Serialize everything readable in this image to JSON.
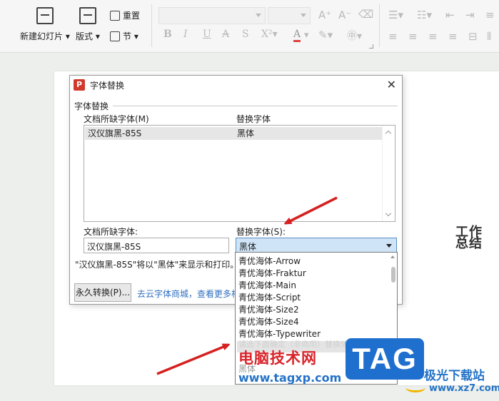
{
  "ribbon": {
    "new_slide": "新建幻灯片",
    "layout": "版式",
    "reset": "重置",
    "section": "节",
    "font_color_letter": "A"
  },
  "dialog": {
    "title": "字体替换",
    "logo_letter": "P",
    "group_label": "字体替换",
    "col_missing": "文档所缺字体(M)",
    "col_replace": "替换字体",
    "list_rows": [
      {
        "missing": "汉仪旗黑-85S",
        "replace": "黑体"
      }
    ],
    "missing_label": "文档所缺字体:",
    "replace_label": "替换字体(S):",
    "missing_value": "汉仪旗黑-85S",
    "replace_value": "黑体",
    "info_text": "\"汉仪旗黑-85S\"将以\"黑体\"来显示和打印。",
    "permanent_button": "永久转换(P)...",
    "link_text": "去云字体商城，查看更多相"
  },
  "dropdown": {
    "options": [
      "青优海体-Arrow",
      "青优海体-Fraktur",
      "青优海体-Main",
      "青优海体-Script",
      "青优海体-Size2",
      "青优海体-Size4",
      "青优海体-Typewriter"
    ],
    "faint_item": "请选下面确定（非商用）替换体",
    "last_item": "黑体"
  },
  "slide": {
    "text": "工作总结"
  },
  "watermark": {
    "site_name": "电脑技术网",
    "site_url": "www.tagxp.com",
    "tag": "TAG",
    "jiguang": "极光下载站",
    "xz_url": "www.xz7.com"
  },
  "colors": {
    "accent_red": "#d9232a",
    "arrow_red": "#d62020",
    "link_blue": "#2f6fc0",
    "tag_blue": "#1f6fcf"
  }
}
